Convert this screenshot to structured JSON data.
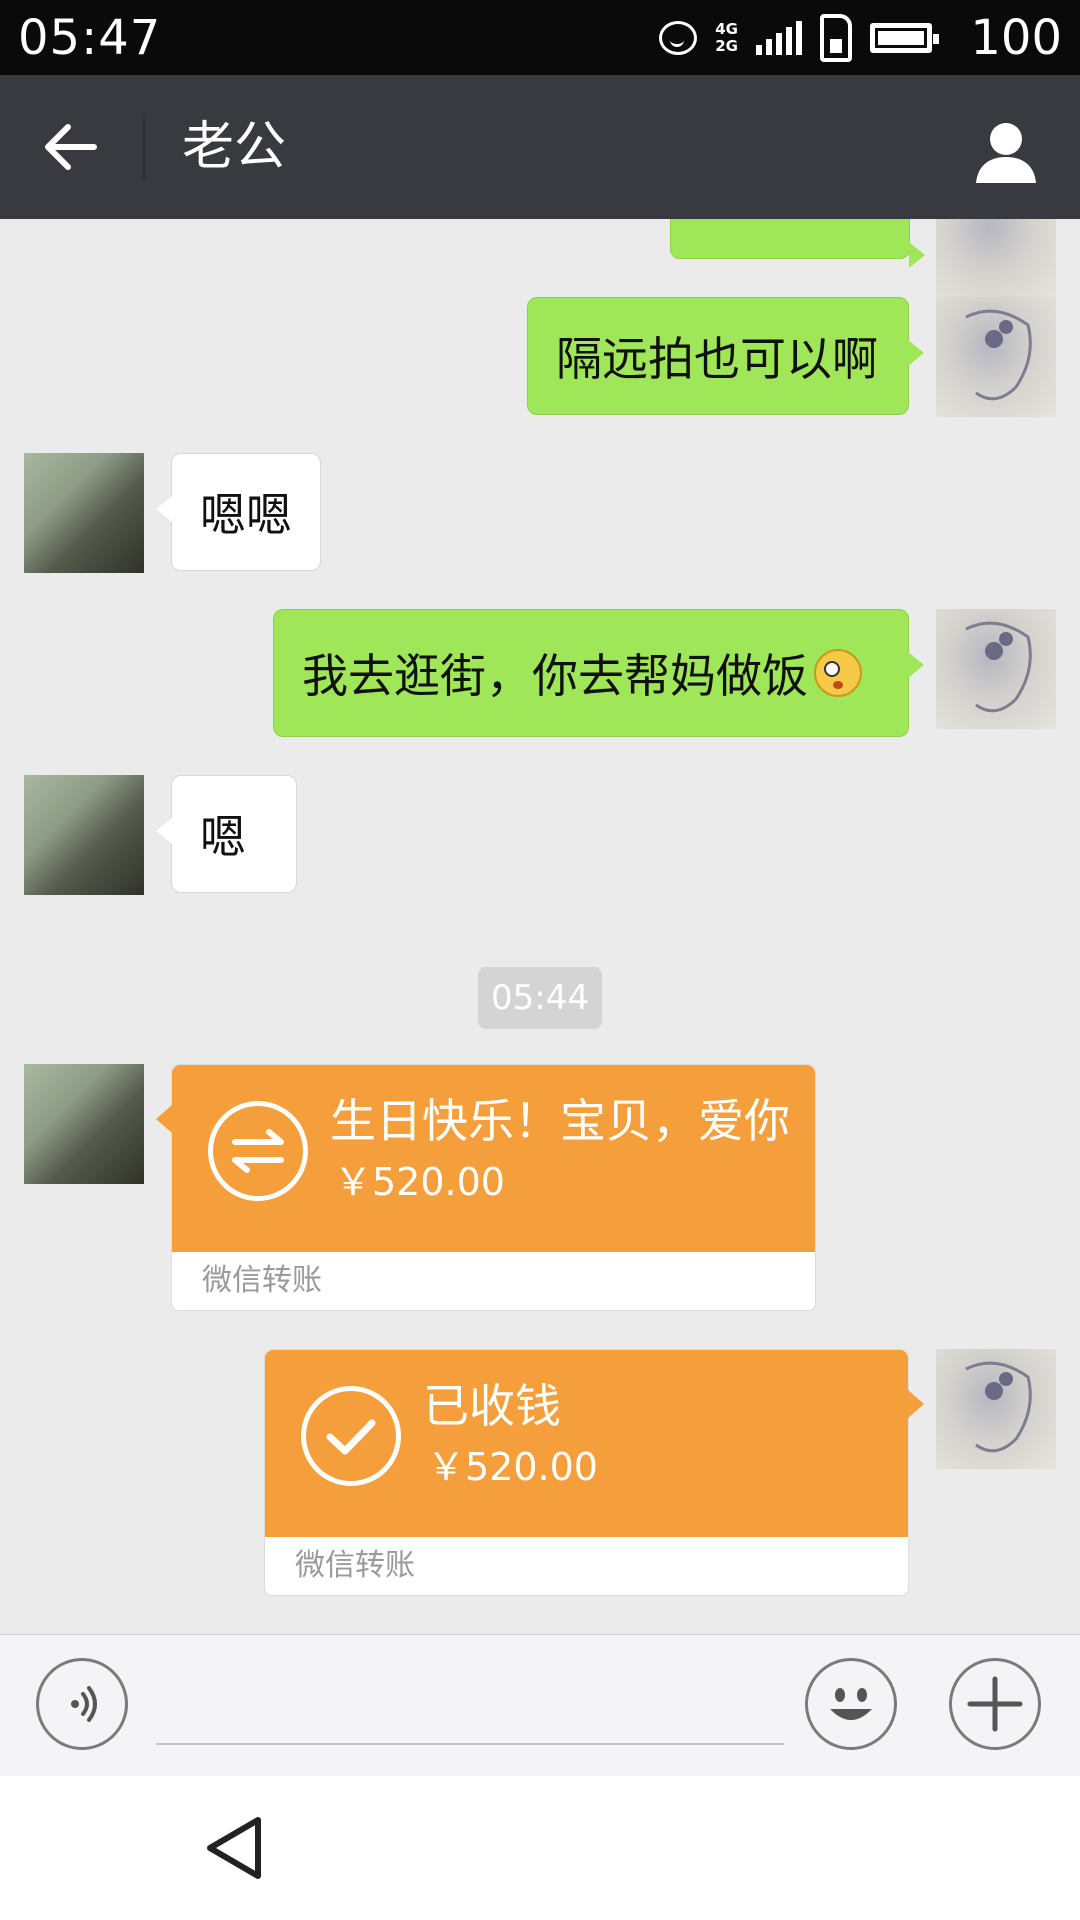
{
  "status_bar": {
    "time": "05:47",
    "network_top": "4G",
    "network_bottom": "2G",
    "battery": "100"
  },
  "header": {
    "back_icon": "arrow-left-icon",
    "title": "老公",
    "profile_icon": "person-icon"
  },
  "messages": [
    {
      "side": "right",
      "text": "隔远拍也可以啊"
    },
    {
      "side": "left",
      "text": "嗯嗯"
    },
    {
      "side": "right",
      "text": "我去逛街，你去帮妈做饭",
      "emoji": "rolling-eyes-emoji-icon"
    },
    {
      "side": "left",
      "text": "嗯"
    }
  ],
  "timestamp": "05:44",
  "transfers": [
    {
      "side": "left",
      "message": "生日快乐！宝贝，爱你",
      "amount": "￥520.00",
      "footer": "微信转账",
      "icon": "transfer-arrows-icon"
    },
    {
      "side": "right",
      "message": "已收钱",
      "amount": "￥520.00",
      "footer": "微信转账",
      "icon": "checkmark-icon"
    }
  ],
  "input_bar": {
    "voice_icon": "voice-icon",
    "text_value": "",
    "emoji_icon": "smiley-icon",
    "plus_icon": "plus-icon"
  },
  "colors": {
    "header_bg": "#393a3f",
    "sent_bubble": "#9fe658",
    "transfer": "#f59f3c"
  }
}
